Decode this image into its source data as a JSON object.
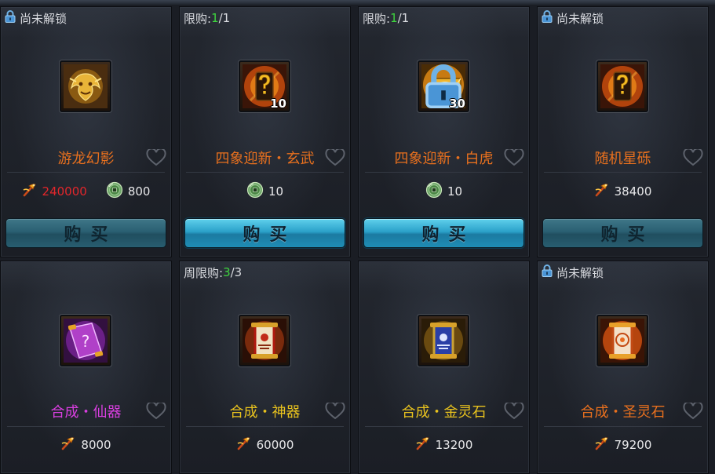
{
  "items": [
    {
      "tag_type": "locked",
      "tag_text": "尚未解锁",
      "name": "游龙幻影",
      "name_color": "#e8701e",
      "icon": "golden-dragon-icon",
      "qty": "",
      "qty_locked": false,
      "prices": [
        {
          "icon": "yuanbao-icon",
          "value": "240000",
          "color": "#e3262b"
        },
        {
          "icon": "jade-coin-icon",
          "value": "800",
          "color": "#e8e8ea"
        }
      ],
      "button_label": "购买",
      "button_state": "dim"
    },
    {
      "tag_type": "limit",
      "tag_label": "限购:",
      "tag_count": "1",
      "tag_total": "/1",
      "name": "四象迎新・玄武",
      "name_color": "#e8701e",
      "icon": "mystery-box-icon",
      "qty": "10",
      "qty_locked": false,
      "prices": [
        {
          "icon": "jade-coin-icon",
          "value": "10",
          "color": "#e8e8ea"
        }
      ],
      "button_label": "购买",
      "button_state": "active"
    },
    {
      "tag_type": "limit",
      "tag_label": "限购:",
      "tag_count": "1",
      "tag_total": "/1",
      "name": "四象迎新・白虎",
      "name_color": "#e8701e",
      "icon": "gold-bar-icon",
      "qty": "30",
      "qty_locked": true,
      "prices": [
        {
          "icon": "jade-coin-icon",
          "value": "10",
          "color": "#e8e8ea"
        }
      ],
      "button_label": "购买",
      "button_state": "active"
    },
    {
      "tag_type": "locked",
      "tag_text": "尚未解锁",
      "name": "随机星砾",
      "name_color": "#e8701e",
      "icon": "mystery-box-icon",
      "qty": "",
      "qty_locked": false,
      "prices": [
        {
          "icon": "yuanbao-icon",
          "value": "38400",
          "color": "#e8e8ea"
        }
      ],
      "button_label": "购买",
      "button_state": "dim"
    },
    {
      "tag_type": "none",
      "name": "合成・仙器",
      "name_color": "#d93fe0",
      "icon": "purple-scroll-icon",
      "qty": "",
      "qty_locked": false,
      "prices": [
        {
          "icon": "yuanbao-icon",
          "value": "8000",
          "color": "#e8e8ea"
        }
      ]
    },
    {
      "tag_type": "limit",
      "tag_label": "周限购:",
      "tag_count": "3",
      "tag_total": "/3",
      "name": "合成・神器",
      "name_color": "#e8c21e",
      "icon": "red-scroll-icon",
      "qty": "",
      "qty_locked": false,
      "prices": [
        {
          "icon": "yuanbao-icon",
          "value": "60000",
          "color": "#e8e8ea"
        }
      ]
    },
    {
      "tag_type": "none",
      "name": "合成・金灵石",
      "name_color": "#e8c21e",
      "icon": "blue-scroll-icon",
      "qty": "",
      "qty_locked": false,
      "prices": [
        {
          "icon": "yuanbao-icon",
          "value": "13200",
          "color": "#e8e8ea"
        }
      ]
    },
    {
      "tag_type": "locked",
      "tag_text": "尚未解锁",
      "name": "合成・圣灵石",
      "name_color": "#e8701e",
      "icon": "orange-scroll-icon",
      "qty": "",
      "qty_locked": false,
      "prices": [
        {
          "icon": "yuanbao-icon",
          "value": "79200",
          "color": "#e8e8ea"
        }
      ]
    }
  ]
}
